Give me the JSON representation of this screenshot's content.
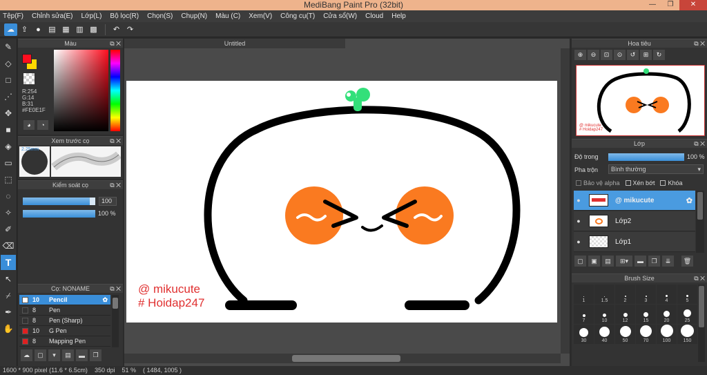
{
  "window": {
    "title": "MediBang Paint Pro (32bit)",
    "min": "—",
    "max": "❐",
    "close": "✕"
  },
  "menu": [
    "Tệp(F)",
    "Chỉnh sửa(E)",
    "Lớp(L)",
    "Bộ lọc(R)",
    "Chọn(S)",
    "Chụp(N)",
    "Màu (C)",
    "Xem(V)",
    "Công cụ(T)",
    "Cửa sổ(W)",
    "Cloud",
    "Help"
  ],
  "toolbar_icons": [
    "cloud-icon",
    "share-icon",
    "comment-icon",
    "note-icon",
    "page-icon",
    "grid-page-icon",
    "tiles-icon",
    "undo-icon",
    "redo-icon"
  ],
  "tools": [
    "brush-icon",
    "eraser-icon",
    "rectangle-icon",
    "dotted-brush-icon",
    "move-icon",
    "fill-rect-icon",
    "bucket-icon",
    "gradient-icon",
    "select-rect-icon",
    "lasso-icon",
    "magic-wand-icon",
    "select-pen-icon",
    "select-eraser-icon",
    "text-icon",
    "operation-icon",
    "eyedropper-icon",
    "dropper-icon",
    "hand-icon"
  ],
  "text_tool_glyph": "T",
  "color_panel": {
    "title": "Màu",
    "r": "R:254",
    "g": "G:14",
    "b": "B:31",
    "hex": "#FE0E1F",
    "fg": "#fe0e1f",
    "bg": "#ffd800"
  },
  "brush_preview": {
    "title": "Xem trước cọ",
    "size_label": "2.25mm"
  },
  "brush_control": {
    "title": "Kiểm soát cọ",
    "size_value": "100",
    "opacity_value": "100 %",
    "size_fraction": 0.92,
    "opacity_fraction": 1.0
  },
  "brush_list": {
    "title": "Cọ: NONAME",
    "items": [
      {
        "size": "10",
        "name": "Pencil",
        "color": "#ffffff"
      },
      {
        "size": "8",
        "name": "Pen",
        "color": "#333333"
      },
      {
        "size": "8",
        "name": "Pen (Sharp)",
        "color": "#333333"
      },
      {
        "size": "10",
        "name": "G Pen",
        "color": "#e02020"
      },
      {
        "size": "8",
        "name": "Mapping Pen",
        "color": "#e02020"
      }
    ]
  },
  "document": {
    "tab_title": "Untitled",
    "signature_line1": "@ mikucute",
    "signature_line2": "# Hoidap247"
  },
  "navigator": {
    "title": "Hoa tiêu",
    "tools": [
      "zoom-in-icon",
      "zoom-out-icon",
      "fit-icon",
      "zoom-100-icon",
      "rotate-left-icon",
      "reset-view-icon",
      "rotate-right-icon"
    ]
  },
  "layer_panel": {
    "title": "Lớp",
    "opacity_label": "Độ trong",
    "opacity_value": "100 %",
    "opacity_fraction": 1.0,
    "blend_label": "Pha trộn",
    "blend_value": "Bình thường",
    "protect_alpha": "Bảo vệ alpha",
    "clipping": "Xén bớt",
    "lock": "Khóa",
    "layers": [
      {
        "name": "@ mikucute",
        "selected": true
      },
      {
        "name": "Lớp2",
        "selected": false
      },
      {
        "name": "Lớp1",
        "selected": false
      }
    ]
  },
  "brush_size": {
    "title": "Brush Size",
    "sizes": [
      "1",
      "1.5",
      "2",
      "3",
      "4",
      "5",
      "7",
      "10",
      "12",
      "15",
      "20",
      "25",
      "30",
      "40",
      "50",
      "70",
      "100",
      "150"
    ]
  },
  "status": {
    "dimensions": "1600 * 900 pixel",
    "physical": "(11.6 * 6.5cm)",
    "dpi": "350 dpi",
    "zoom": "51 %",
    "coords": "( 1484, 1005 )"
  }
}
